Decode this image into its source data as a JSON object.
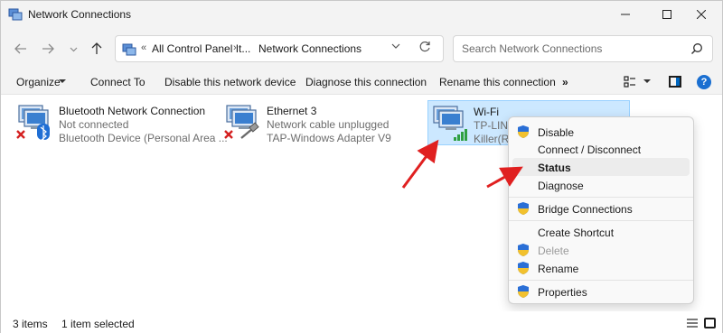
{
  "window": {
    "title": "Network Connections",
    "controls": {
      "minimize": "—",
      "maximize": "☐",
      "close": "✕"
    }
  },
  "nav": {
    "back_icon": "arrow-left-icon",
    "forward_icon": "arrow-right-icon",
    "recent_icon": "chevron-down-icon",
    "up_icon": "arrow-up-icon"
  },
  "address": {
    "overflow": "«",
    "crumb_1": "All Control Panel It...",
    "separator": "›",
    "crumb_2": "Network Connections"
  },
  "search": {
    "placeholder": "Search Network Connections"
  },
  "toolbar": {
    "organize": "Organize",
    "connect_to": "Connect To",
    "disable_device": "Disable this network device",
    "diagnose": "Diagnose this connection",
    "rename": "Rename this connection",
    "more": "»",
    "help": "?"
  },
  "connections": [
    {
      "name": "Bluetooth Network Connection",
      "status": "Not connected",
      "device": "Bluetooth Device (Personal Area ...",
      "icon": "bluetooth-network-icon"
    },
    {
      "name": "Ethernet 3",
      "status": "Network cable unplugged",
      "device": "TAP-Windows Adapter V9",
      "icon": "ethernet-network-icon"
    },
    {
      "name": "Wi-Fi",
      "status": "TP-LINK",
      "device": "Killer(R)",
      "icon": "wifi-network-icon",
      "selected": true
    }
  ],
  "context_menu": {
    "items": [
      {
        "label": "Disable",
        "shield": true
      },
      {
        "label": "Connect / Disconnect",
        "shield": false
      },
      {
        "label": "Status",
        "shield": false,
        "bold": true
      },
      {
        "label": "Diagnose",
        "shield": false
      },
      {
        "label": "Bridge Connections",
        "shield": true
      },
      {
        "label": "Create Shortcut",
        "shield": false
      },
      {
        "label": "Delete",
        "shield": true,
        "disabled": true
      },
      {
        "label": "Rename",
        "shield": true
      },
      {
        "label": "Properties",
        "shield": true
      }
    ]
  },
  "statusbar": {
    "items_count": "3 items",
    "selected": "1 item selected"
  },
  "colors": {
    "selection_bg": "#cce8ff",
    "arrow": "#e02020",
    "accent": "#0067c0"
  }
}
